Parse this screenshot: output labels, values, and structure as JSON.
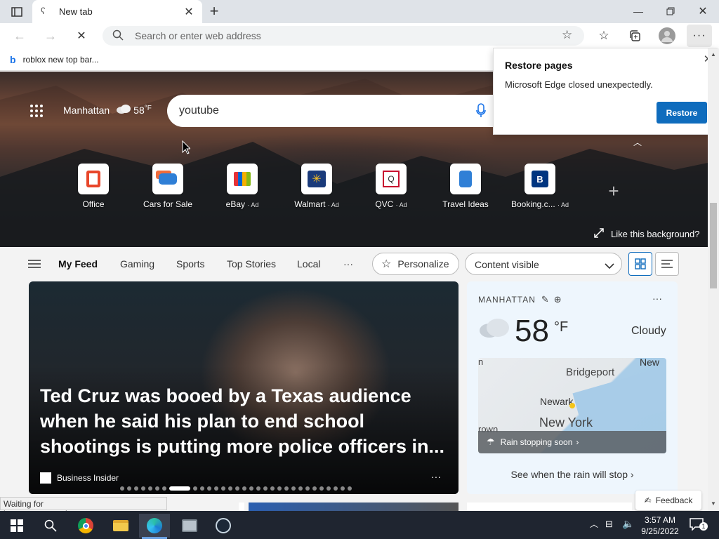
{
  "tab": {
    "title": "New tab"
  },
  "address": {
    "placeholder": "Search or enter web address"
  },
  "favorites": {
    "item": "roblox new top bar..."
  },
  "restore": {
    "title": "Restore pages",
    "message": "Microsoft Edge closed unexpectedly.",
    "button": "Restore"
  },
  "hero": {
    "location": "Manhattan",
    "temp": "58",
    "unit": "°F",
    "search_value": "youtube",
    "like_bg": "Like this background?"
  },
  "quick_links": [
    {
      "label": "Office",
      "ad": ""
    },
    {
      "label": "Cars for Sale",
      "ad": ""
    },
    {
      "label": "eBay",
      "ad": "· Ad"
    },
    {
      "label": "Walmart",
      "ad": "· Ad"
    },
    {
      "label": "QVC",
      "ad": "· Ad"
    },
    {
      "label": "Travel Ideas",
      "ad": ""
    },
    {
      "label": "Booking.c...",
      "ad": "· Ad"
    }
  ],
  "feed": {
    "tabs": [
      "My Feed",
      "Gaming",
      "Sports",
      "Top Stories",
      "Local"
    ],
    "personalize": "Personalize",
    "content_visible": "Content visible"
  },
  "article": {
    "headline": "Ted Cruz was booed by a Texas audience when he said his plan to end school shootings is putting more police officers in...",
    "source": "Business Insider"
  },
  "weather": {
    "location": "MANHATTAN",
    "temp": "58",
    "unit": "°F",
    "condition": "Cloudy",
    "map_labels": [
      "Bridgeport",
      "New",
      "Newark",
      "New York",
      "n",
      "rown"
    ],
    "rain_msg": "Rain stopping soon",
    "see_rain": "See when the rain will stop"
  },
  "feedback": "Feedback",
  "status": "Waiting for browser.events.data.msn.com...",
  "clock": {
    "time": "3:57 AM",
    "date": "9/25/2022"
  },
  "notification_count": "1"
}
